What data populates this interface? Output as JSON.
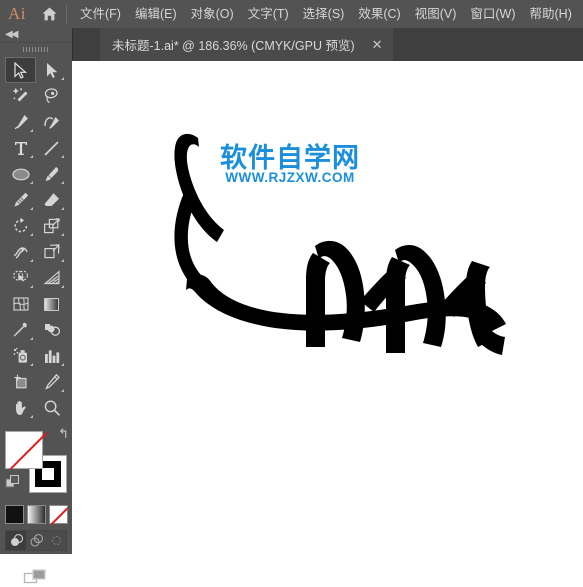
{
  "app": {
    "logo_text": "Ai",
    "home_icon": "home-icon"
  },
  "menubar": {
    "items": [
      {
        "label": "文件(F)",
        "name": "menu-file"
      },
      {
        "label": "编辑(E)",
        "name": "menu-edit"
      },
      {
        "label": "对象(O)",
        "name": "menu-object"
      },
      {
        "label": "文字(T)",
        "name": "menu-type"
      },
      {
        "label": "选择(S)",
        "name": "menu-select"
      },
      {
        "label": "效果(C)",
        "name": "menu-effect"
      },
      {
        "label": "视图(V)",
        "name": "menu-view"
      },
      {
        "label": "窗口(W)",
        "name": "menu-window"
      },
      {
        "label": "帮助(H)",
        "name": "menu-help"
      }
    ]
  },
  "tabstrip": {
    "document_tab": {
      "title": "未标题-1.ai* @ 186.36% (CMYK/GPU 预览)",
      "close_label": "✕"
    }
  },
  "toolpanel": {
    "collapse_arrows": "◀◀",
    "tools": [
      {
        "name": "selection-tool",
        "label": "选择工具",
        "active": true,
        "corner": false
      },
      {
        "name": "direct-selection-tool",
        "label": "直接选择工具",
        "active": false,
        "corner": true
      },
      {
        "name": "magic-wand-tool",
        "label": "魔棒工具",
        "active": false,
        "corner": false
      },
      {
        "name": "lasso-tool",
        "label": "套索工具",
        "active": false,
        "corner": false
      },
      {
        "name": "pen-tool",
        "label": "钢笔工具",
        "active": false,
        "corner": true
      },
      {
        "name": "curvature-tool",
        "label": "曲率工具",
        "active": false,
        "corner": false
      },
      {
        "name": "type-tool",
        "label": "文字工具",
        "active": false,
        "corner": true
      },
      {
        "name": "line-segment-tool",
        "label": "直线段工具",
        "active": false,
        "corner": true
      },
      {
        "name": "ellipse-tool",
        "label": "椭圆工具",
        "active": false,
        "corner": true
      },
      {
        "name": "paintbrush-tool",
        "label": "画笔工具",
        "active": false,
        "corner": true
      },
      {
        "name": "shaper-tool",
        "label": "Shaper 工具",
        "active": false,
        "corner": true
      },
      {
        "name": "eraser-tool",
        "label": "橡皮擦工具",
        "active": false,
        "corner": true
      },
      {
        "name": "rotate-tool",
        "label": "旋转工具",
        "active": false,
        "corner": true
      },
      {
        "name": "scale-tool",
        "label": "比例缩放工具",
        "active": false,
        "corner": true
      },
      {
        "name": "width-tool",
        "label": "宽度工具",
        "active": false,
        "corner": true
      },
      {
        "name": "free-transform-tool",
        "label": "自由变换工具",
        "active": false,
        "corner": true
      },
      {
        "name": "shape-builder-tool",
        "label": "形状生成器工具",
        "active": false,
        "corner": true
      },
      {
        "name": "perspective-grid-tool",
        "label": "透视网格工具",
        "active": false,
        "corner": true
      },
      {
        "name": "mesh-tool",
        "label": "网格工具",
        "active": false,
        "corner": false
      },
      {
        "name": "gradient-tool",
        "label": "渐变工具",
        "active": false,
        "corner": false
      },
      {
        "name": "eyedropper-tool",
        "label": "吸管工具",
        "active": false,
        "corner": true
      },
      {
        "name": "blend-tool",
        "label": "混合工具",
        "active": false,
        "corner": false
      },
      {
        "name": "symbol-sprayer-tool",
        "label": "符号喷枪工具",
        "active": false,
        "corner": true
      },
      {
        "name": "column-graph-tool",
        "label": "柱形图工具",
        "active": false,
        "corner": true
      },
      {
        "name": "artboard-tool",
        "label": "画板工具",
        "active": false,
        "corner": false
      },
      {
        "name": "slice-tool",
        "label": "切片工具",
        "active": false,
        "corner": true
      },
      {
        "name": "hand-tool",
        "label": "抓手工具",
        "active": false,
        "corner": true
      },
      {
        "name": "zoom-tool",
        "label": "缩放工具",
        "active": false,
        "corner": false
      }
    ],
    "color_controls": {
      "fill_name": "fill-swatch",
      "fill_value": "无",
      "stroke_name": "stroke-swatch",
      "stroke_value": "黑色",
      "swap_icon": "swap-colors-icon",
      "default_icon": "default-colors-icon",
      "modes": [
        {
          "name": "color-mode-button",
          "label": "颜色"
        },
        {
          "name": "gradient-mode-button",
          "label": "渐变"
        },
        {
          "name": "none-mode-button",
          "label": "无",
          "active": true
        }
      ],
      "draw_modes": [
        {
          "name": "draw-normal-button",
          "label": "正常绘图",
          "active": true
        },
        {
          "name": "draw-behind-button",
          "label": "背面绘图",
          "active": false
        },
        {
          "name": "draw-inside-button",
          "label": "内部绘图",
          "active": false
        }
      ],
      "screen_mode": {
        "name": "change-screen-mode-button",
        "label": "更改屏幕模式"
      }
    }
  },
  "canvas": {
    "watermark": {
      "main": "软件自学网",
      "sub": "WWW.RJZXW.COM",
      "color": "#1b8fdc",
      "outline_color": "#ffffff"
    },
    "artwork": {
      "name": "brush-stroke-artwork",
      "fill_color": "#000000",
      "background": "#ffffff"
    }
  },
  "colors": {
    "chrome": "#535353",
    "tabstrip": "#3f3f3f",
    "tab_active": "#4a4a4a",
    "text": "#d6d6d6",
    "accent": "#d08f5e",
    "canvas": "#ffffff"
  }
}
